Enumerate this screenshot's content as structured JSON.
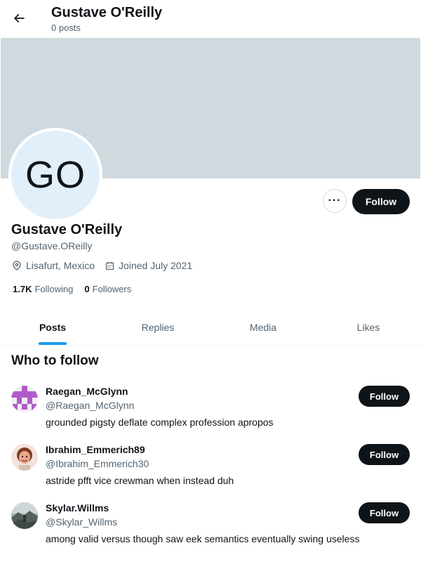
{
  "header": {
    "back_icon": "arrow-left-icon",
    "title": "Gustave O'Reilly",
    "subtitle": "0 posts"
  },
  "profile": {
    "avatar_initials": "GO",
    "avatar_bg": "#e1effa",
    "banner_color": "#cfd9de",
    "name": "Gustave O'Reilly",
    "handle": "@Gustave.OReilly",
    "location": "Lisafurt, Mexico",
    "joined": "Joined July 2021",
    "following_count": "1.7K",
    "following_label": "Following",
    "followers_count": "0",
    "followers_label": "Followers",
    "more_label": "···",
    "follow_label": "Follow"
  },
  "tabs": [
    {
      "label": "Posts",
      "active": true
    },
    {
      "label": "Replies",
      "active": false
    },
    {
      "label": "Media",
      "active": false
    },
    {
      "label": "Likes",
      "active": false
    }
  ],
  "who_to_follow": {
    "title": "Who to follow",
    "items": [
      {
        "name": "Raegan_McGlynn",
        "handle": "@Raegan_McGlynn",
        "bio": "grounded pigsty deflate complex profession apropos",
        "follow_label": "Follow"
      },
      {
        "name": "Ibrahim_Emmerich89",
        "handle": "@Ibrahim_Emmerich30",
        "bio": "astride pfft vice crewman when instead duh",
        "follow_label": "Follow"
      },
      {
        "name": "Skylar.Willms",
        "handle": "@Skylar_Willms",
        "bio": "among valid versus though saw eek semantics eventually swing useless",
        "follow_label": "Follow"
      }
    ]
  },
  "colors": {
    "accent": "#1d9bf0",
    "button_dark": "#0f1419",
    "muted_text": "#536471"
  }
}
